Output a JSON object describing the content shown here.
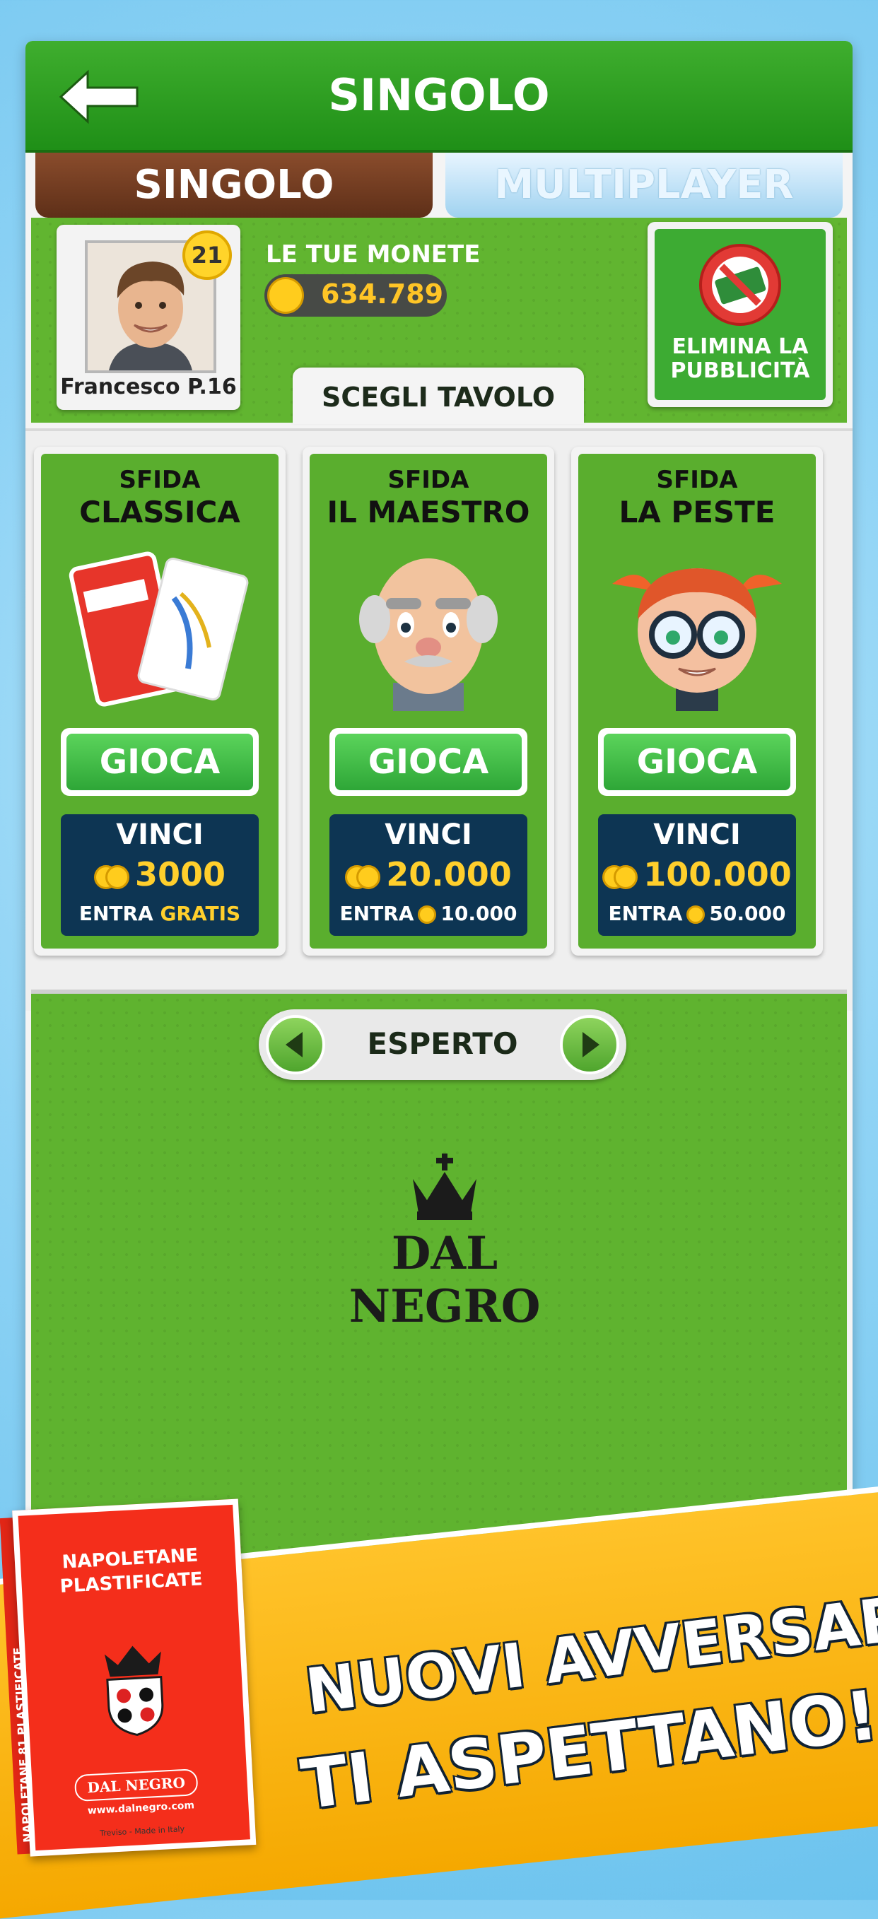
{
  "header": {
    "title": "SINGOLO"
  },
  "tabs": [
    {
      "label": "SINGOLO"
    },
    {
      "label": "MULTIPLAYER"
    }
  ],
  "player": {
    "name": "Francesco P.16",
    "level": "21"
  },
  "coins": {
    "label": "LE TUE MONETE",
    "value": "634.789"
  },
  "no_ads": {
    "label_line1": "ELIMINA LA",
    "label_line2": "PUBBLICITÀ"
  },
  "choose_table": "SCEGLI TAVOLO",
  "tables": [
    {
      "line1": "SFIDA",
      "line2": "CLASSICA",
      "button": "GIOCA",
      "win_label": "VINCI",
      "prize": "3000",
      "entry_label": "ENTRA",
      "entry_value": "GRATIS",
      "art": "cards-art"
    },
    {
      "line1": "SFIDA",
      "line2": "IL MAESTRO",
      "button": "GIOCA",
      "win_label": "VINCI",
      "prize": "20.000",
      "entry_label": "ENTRA",
      "entry_value": "10.000",
      "art": "old-man-art"
    },
    {
      "line1": "SFIDA",
      "line2": "LA PESTE",
      "button": "GIOCA",
      "win_label": "VINCI",
      "prize": "100.000",
      "entry_label": "ENTRA",
      "entry_value": "50.000",
      "art": "girl-art"
    }
  ],
  "difficulty": {
    "label": "ESPERTO"
  },
  "brand": {
    "name": "DAL NEGRO"
  },
  "promo": {
    "line1": "NUOVI AVVERSARI",
    "line2": "TI ASPETTANO!"
  },
  "deck": {
    "title_line1": "NAPOLETANE",
    "title_line2": "PLASTIFICATE",
    "brand": "DAL NEGRO",
    "url": "www.dalnegro.com",
    "made": "Treviso - Made in Italy",
    "side": "NAPOLETANE 81 PLASTIFICATE"
  },
  "colors": {
    "header_green": "#2a9a1f",
    "table_green": "#5aae2e",
    "prize_navy": "#0d3553",
    "gold": "#ffc526",
    "banner_yellow": "#ffc32a"
  }
}
